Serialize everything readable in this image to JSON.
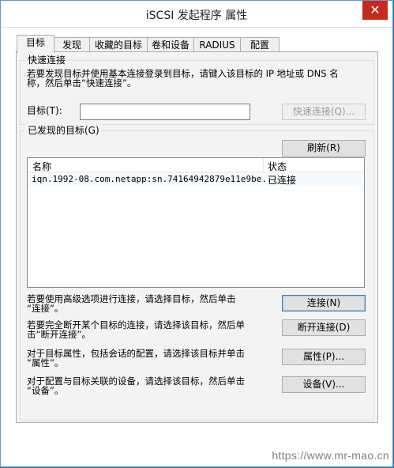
{
  "window": {
    "title": "iSCSI 发起程序 属性",
    "close_glyph": "✕"
  },
  "tabs": [
    {
      "label": "目标"
    },
    {
      "label": "发现"
    },
    {
      "label": "收藏的目标"
    },
    {
      "label": "卷和设备"
    },
    {
      "label": "RADIUS"
    },
    {
      "label": "配置"
    }
  ],
  "quick_connect": {
    "title": "快速连接",
    "description_line1": "若要发现目标并使用基本连接登录到目标，请键入该目标的 IP 地址或 DNS 名",
    "description_line2": "称，然后单击“快速连接”。",
    "target_label": "目标(T):",
    "target_value": "",
    "button_label": "快速连接(Q)..."
  },
  "discovered": {
    "title": "已发现的目标(G)",
    "refresh_label": "刷新(R)",
    "columns": {
      "name": "名称",
      "status": "状态"
    },
    "rows": [
      {
        "name": "iqn.1992-08.com.netapp:sn.74164942879e11e9be...",
        "status": "已连接"
      }
    ]
  },
  "actions": [
    {
      "line1": "若要使用高级选项进行连接，请选择目标，然后单击",
      "line2": "“连接”。",
      "button": "连接(N)"
    },
    {
      "line1": "若要完全断开某个目标的连接，请选择该目标，然后单",
      "line2": "击“断开连接”。",
      "button": "断开连接(D)"
    },
    {
      "line1": "对于目标属性，包括会话的配置，请选择该目标并单击",
      "line2": "“属性”。",
      "button": "属性(P)..."
    },
    {
      "line1": "对于配置与目标关联的设备，请选择该目标，然后单击",
      "line2": "“设备”。",
      "button": "设备(V)..."
    }
  ],
  "watermark": "https://www.mr-mao.cn",
  "colors": {
    "accent": "#3c7fb1",
    "close": "#c42b1c",
    "selected_row": "#f4f9fd"
  }
}
